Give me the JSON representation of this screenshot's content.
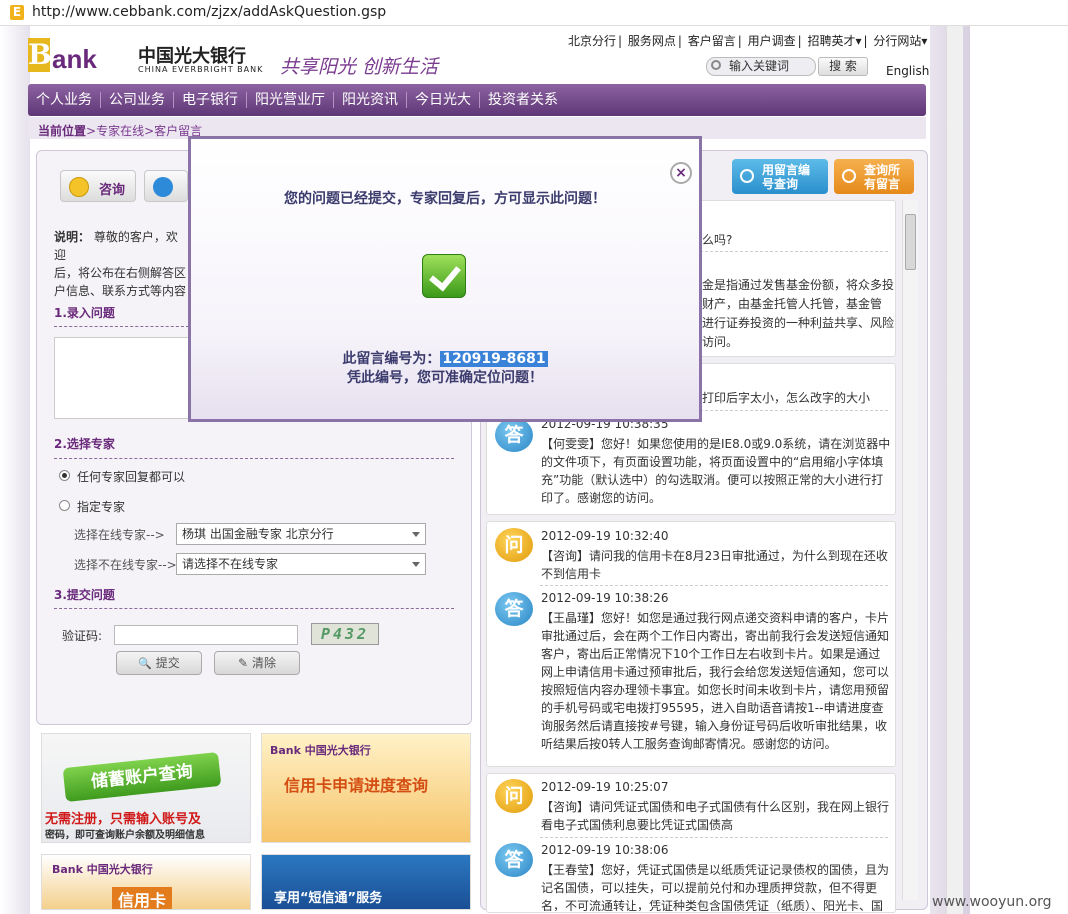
{
  "browser": {
    "url": "http://www.cebbank.com/zjzx/addAskQuestion.gsp",
    "favicon": "E"
  },
  "header": {
    "logo_b": "B",
    "logo_rest": "ank",
    "bank_cn": "中国光大银行",
    "bank_en": "CHINA EVERBRIGHT BANK",
    "slogan": "共享阳光 创新生活",
    "toplinks": [
      "北京分行",
      "服务网点",
      "客户留言",
      "用户调查",
      "招聘英才▾",
      "分行网站▾"
    ],
    "search_placeholder": "输入关键词",
    "search_btn": "搜 索",
    "english": "English"
  },
  "nav": [
    "个人业务",
    "公司业务",
    "电子银行",
    "阳光营业厅",
    "阳光资讯",
    "今日光大",
    "投资者关系"
  ],
  "breadcrumb": {
    "label": "当前位置",
    "path": ">专家在线>客户留言"
  },
  "left": {
    "tab_ask": "咨询",
    "note_label": "说明：",
    "note_lines": [
      "尊敬的客户，欢迎",
      "后，将公布在右侧解答区",
      "户信息、联系方式等内容"
    ],
    "sec1": "1.录入问题",
    "sec2": "2.选择专家",
    "radio_any": "任何专家回复都可以",
    "radio_specific": "指定专家",
    "online_label": "选择在线专家-->",
    "online_value": "杨琪        出国金融专家      北京分行",
    "offline_label": "选择不在线专家-->",
    "offline_value": "请选择不在线专家",
    "sec3": "3.提交问题",
    "captcha_label": "验证码:",
    "captcha": "P432",
    "submit": "提交",
    "clear": "清除"
  },
  "ads": {
    "a1_title": "储蓄账户查询",
    "a1_l1": "无需注册，只需输入账号及",
    "a1_l2": "密码，即可查询账户余额及明细信息",
    "a2_logo": "Bank 中国光大银行",
    "a2_title": "信用卡申请进度查询",
    "a3_logo": "Bank 中国光大银行",
    "a3_title": "信用卡",
    "a4_title": "享用“短信通”服务"
  },
  "right": {
    "btn_by_no": "用留言编\n号查询",
    "btn_all": "查询所\n有留言",
    "partial": [
      "么吗?",
      "金是指通过发售基金份额，将众多投",
      "财产，由基金托管人托管，基金管",
      "进行证券投资的一种利益共享、风险",
      "访问。"
    ],
    "partial2": "打印后字太小，怎么改字的大小",
    "items": [
      {
        "type": "答",
        "time": "2012-09-19 10:38:35",
        "text": "【何雯雯】您好！如果您使用的是IE8.0或9.0系统，请在浏览器中的文件项下，有页面设置功能，将页面设置中的“启用缩小字体填充”功能（默认选中）的勾选取消。便可以按照正常的大小进行打印了。感谢您的访问。"
      },
      {
        "type": "问",
        "time": "2012-09-19 10:32:40",
        "text": "【咨询】请问我的信用卡在8月23日审批通过，为什么到现在还收不到信用卡"
      },
      {
        "type": "答",
        "time": "2012-09-19 10:38:26",
        "text": "【王晶瑾】您好！如您是通过我行网点递交资料申请的客户，卡片审批通过后，会在两个工作日内寄出，寄出前我行会发送短信通知客户，寄出后正常情况下10个工作日左右收到卡片。如果是通过网上申请信用卡通过预审批后，我行会给您发送短信通知，您可以按照短信内容办理领卡事宜。如您长时间未收到卡片，请您用预留的手机号码或宅电拨打95595，进入自助语音请按1--申请进度查询服务然后请直接按#号键，输入身份证号码后收听审批结果，收听结果后按0转人工服务查询邮寄情况。感谢您的访问。"
      },
      {
        "type": "问",
        "time": "2012-09-19 10:25:07",
        "text": "【咨询】请问凭证式国债和电子式国债有什么区别，我在网上银行看电子式国债利息要比凭证式国债高"
      },
      {
        "type": "答",
        "time": "2012-09-19 10:38:06",
        "text": "【王春莹】您好，凭证式国债是以纸质凭证记录债权的国债，且为记名国债，可以挂失，可以提前兑付和办理质押贷款，但不得更名，不可流通转让，凭证种类包含国债凭证（纸质）、阳光卡、国"
      }
    ]
  },
  "modal": {
    "title": "您的问题已经提交，专家回复后，方可显示此问题！",
    "id_label": "此留言编号为：",
    "id": "120919-8681",
    "line2": "凭此编号，您可准确定位问题！",
    "close": "×"
  },
  "watermark": "www.wooyun.org",
  "colors": {
    "brand": "#6a2a7c",
    "nav": "#7a4e90",
    "accent_gold": "#e6b81e"
  }
}
